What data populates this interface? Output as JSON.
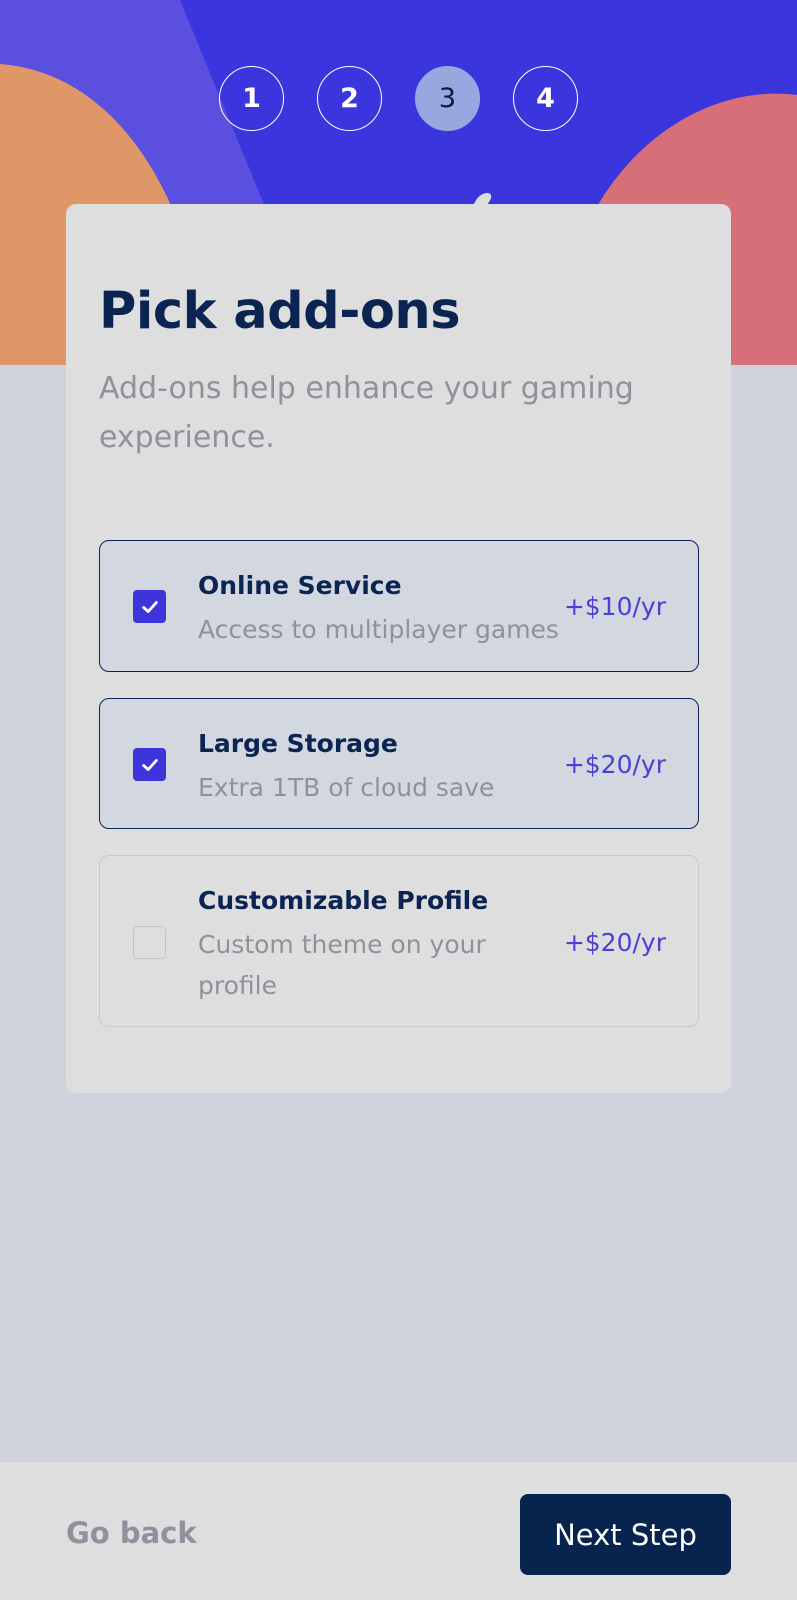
{
  "steps": [
    "1",
    "2",
    "3",
    "4"
  ],
  "active_step": 3,
  "card": {
    "title": "Pick add-ons",
    "subtitle": "Add-ons help enhance your gaming experience."
  },
  "addons": [
    {
      "name": "Online Service",
      "description": "Access to multiplayer games",
      "price": "+$10/yr",
      "checked": true
    },
    {
      "name": "Large Storage",
      "description": "Extra 1TB of cloud save",
      "price": "+$20/yr",
      "checked": true
    },
    {
      "name": "Customizable Profile",
      "description": "Custom theme on your profile",
      "price": "+$20/yr",
      "checked": false
    }
  ],
  "footer": {
    "back_label": "Go back",
    "next_label": "Next Step"
  },
  "colors": {
    "header_bg": "#3b35dd",
    "blob_orange": "#e09767",
    "blob_pink": "#d76f79",
    "accent": "#3d35d9",
    "primary": "#07244f",
    "page_bg": "#cfd3dd"
  }
}
